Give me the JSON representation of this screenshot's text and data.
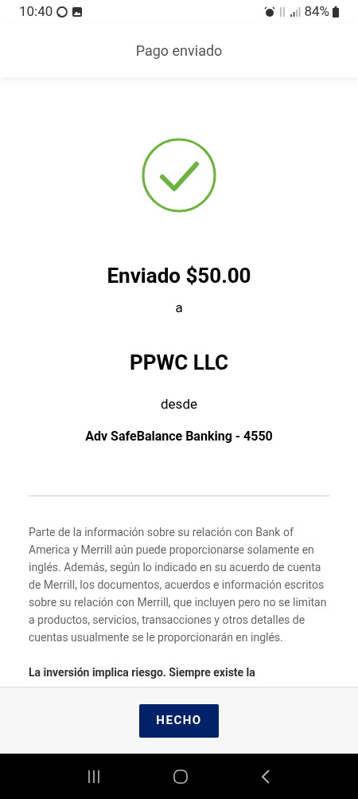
{
  "status_bar": {
    "time": "10:40",
    "battery": "84%"
  },
  "header": {
    "title": "Pago enviado"
  },
  "confirmation": {
    "amount_line": "Enviado $50.00",
    "to_label": "a",
    "recipient": "PPWC LLC",
    "from_label": "desde",
    "account": "Adv SafeBalance Banking - 4550"
  },
  "disclosures": [
    {
      "kind": "normal",
      "text": "Parte de la información sobre su relación con Bank of America y Merrill aún puede proporcionarse solamente en inglés. Además, según lo indicado en su acuerdo de cuenta de Merrill, los documentos, acuerdos e información escritos sobre su relación con Merrill, que incluyen pero no se limitan a productos, servicios, transacciones y otros detalles de cuentas usualmente se le proporcionarán en inglés."
    },
    {
      "kind": "bold",
      "text": "La inversión implica riesgo. Siempre existe la"
    }
  ],
  "footer": {
    "button": "HECHO"
  }
}
